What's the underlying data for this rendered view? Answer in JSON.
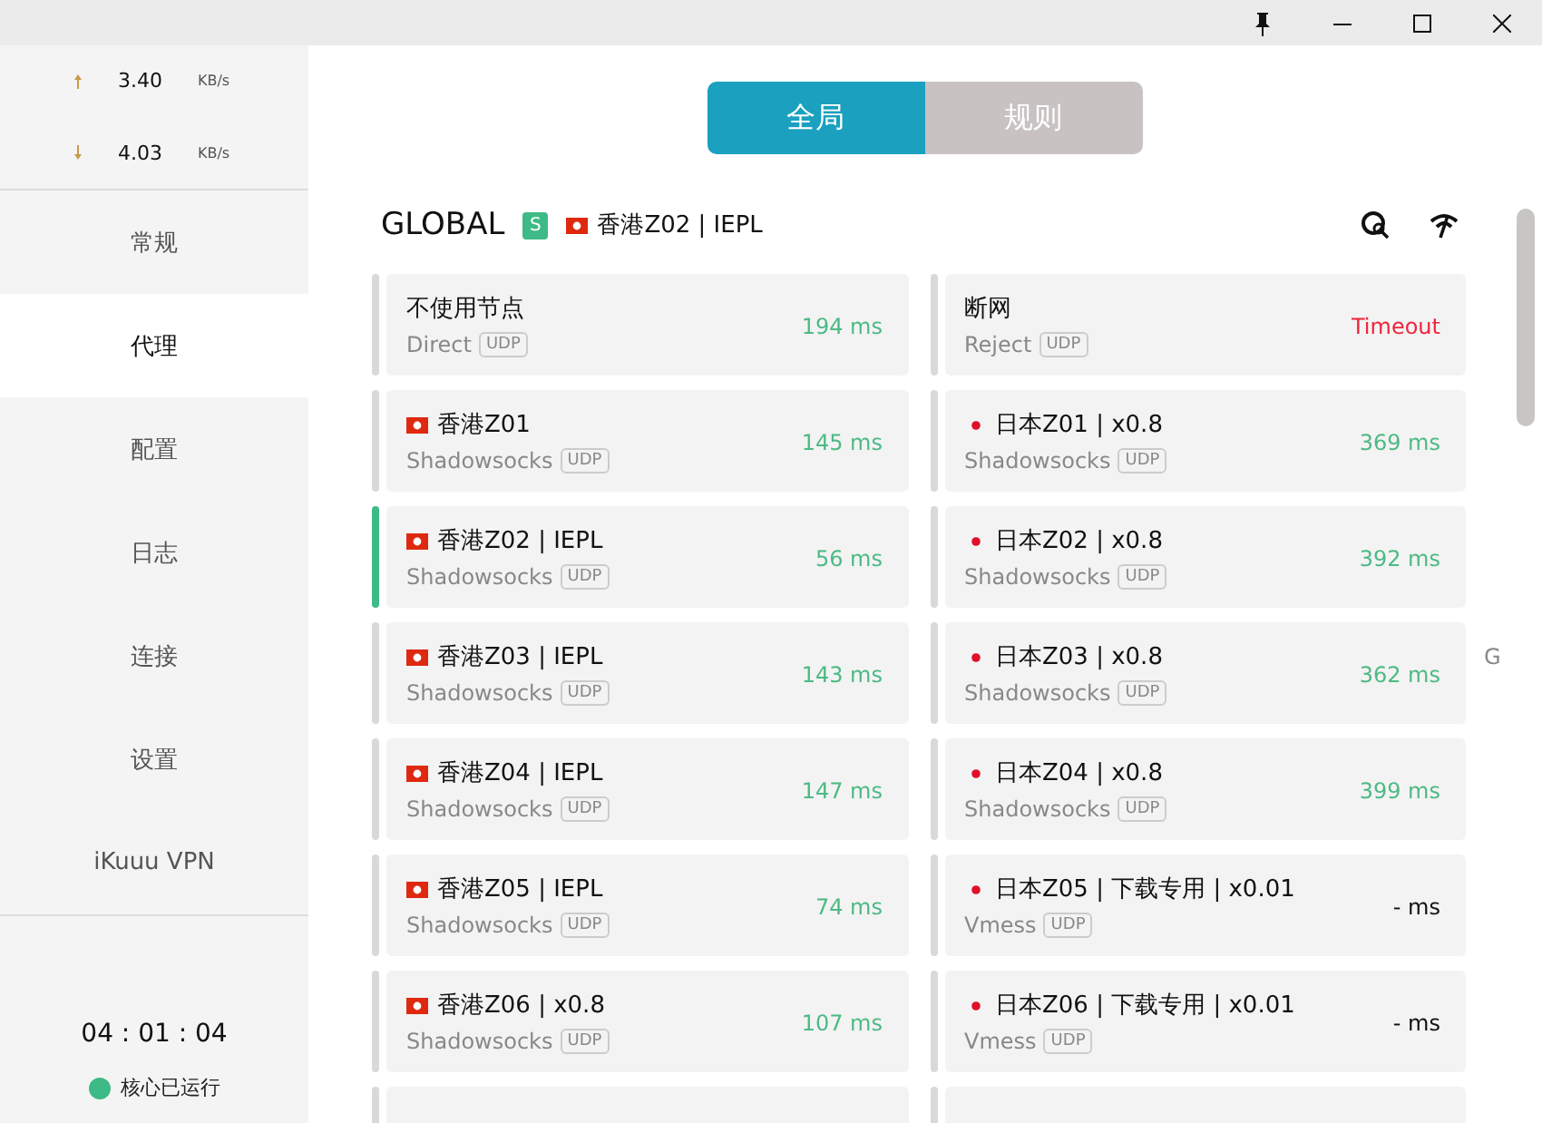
{
  "traffic": [
    {
      "kind": "up",
      "value": "3.40",
      "unit": "KB/s"
    },
    {
      "kind": "down",
      "value": "4.03",
      "unit": "KB/s"
    }
  ],
  "nav": [
    {
      "label": "常规",
      "selected": false
    },
    {
      "label": "代理",
      "selected": true
    },
    {
      "label": "配置",
      "selected": false
    },
    {
      "label": "日志",
      "selected": false
    },
    {
      "label": "连接",
      "selected": false
    },
    {
      "label": "设置",
      "selected": false
    },
    {
      "label": "iKuuu VPN",
      "selected": false
    }
  ],
  "uptime": "04 : 01 : 04",
  "core_status": {
    "label": "核心已运行",
    "color": "#3dba85"
  },
  "mode_tabs": [
    {
      "label": "全局",
      "selected": true
    },
    {
      "label": "规则",
      "selected": false
    }
  ],
  "group": {
    "name": "GLOBAL",
    "badge": "S",
    "current": {
      "kind": "hk",
      "name": "香港Z02 | IEPL"
    }
  },
  "proxies": [
    {
      "kind": "plain",
      "name": "不使用节点",
      "type": "Direct",
      "udp": "UDP",
      "delay": "194 ms",
      "color": "#4cba84",
      "selected": false
    },
    {
      "kind": "plain",
      "name": "断网",
      "type": "Reject",
      "udp": "UDP",
      "delay": "Timeout",
      "color": "#f0243c",
      "selected": false
    },
    {
      "kind": "hk",
      "name": "香港Z01",
      "type": "Shadowsocks",
      "udp": "UDP",
      "delay": "145 ms",
      "color": "#4cba84",
      "selected": false
    },
    {
      "kind": "jp",
      "name": "日本Z01 | x0.8",
      "type": "Shadowsocks",
      "udp": "UDP",
      "delay": "369 ms",
      "color": "#4cba84",
      "selected": false
    },
    {
      "kind": "hk",
      "name": "香港Z02 | IEPL",
      "type": "Shadowsocks",
      "udp": "UDP",
      "delay": "56 ms",
      "color": "#4cba84",
      "selected": true
    },
    {
      "kind": "jp",
      "name": "日本Z02 | x0.8",
      "type": "Shadowsocks",
      "udp": "UDP",
      "delay": "392 ms",
      "color": "#4cba84",
      "selected": false
    },
    {
      "kind": "hk",
      "name": "香港Z03 | IEPL",
      "type": "Shadowsocks",
      "udp": "UDP",
      "delay": "143 ms",
      "color": "#4cba84",
      "selected": false
    },
    {
      "kind": "jp",
      "name": "日本Z03 | x0.8",
      "type": "Shadowsocks",
      "udp": "UDP",
      "delay": "362 ms",
      "color": "#4cba84",
      "selected": false
    },
    {
      "kind": "hk",
      "name": "香港Z04 | IEPL",
      "type": "Shadowsocks",
      "udp": "UDP",
      "delay": "147 ms",
      "color": "#4cba84",
      "selected": false
    },
    {
      "kind": "jp",
      "name": "日本Z04 | x0.8",
      "type": "Shadowsocks",
      "udp": "UDP",
      "delay": "399 ms",
      "color": "#4cba84",
      "selected": false
    },
    {
      "kind": "hk",
      "name": "香港Z05 | IEPL",
      "type": "Shadowsocks",
      "udp": "UDP",
      "delay": "74 ms",
      "color": "#4cba84",
      "selected": false
    },
    {
      "kind": "jp",
      "name": "日本Z05 | 下载专用 | x0.01",
      "type": "Vmess",
      "udp": "UDP",
      "delay": "- ms",
      "color": "#111111",
      "selected": false
    },
    {
      "kind": "hk",
      "name": "香港Z06 | x0.8",
      "type": "Shadowsocks",
      "udp": "UDP",
      "delay": "107 ms",
      "color": "#4cba84",
      "selected": false
    },
    {
      "kind": "jp",
      "name": "日本Z06 | 下载专用 | x0.01",
      "type": "Vmess",
      "udp": "UDP",
      "delay": "- ms",
      "color": "#111111",
      "selected": false
    }
  ],
  "stray_letter": "G"
}
